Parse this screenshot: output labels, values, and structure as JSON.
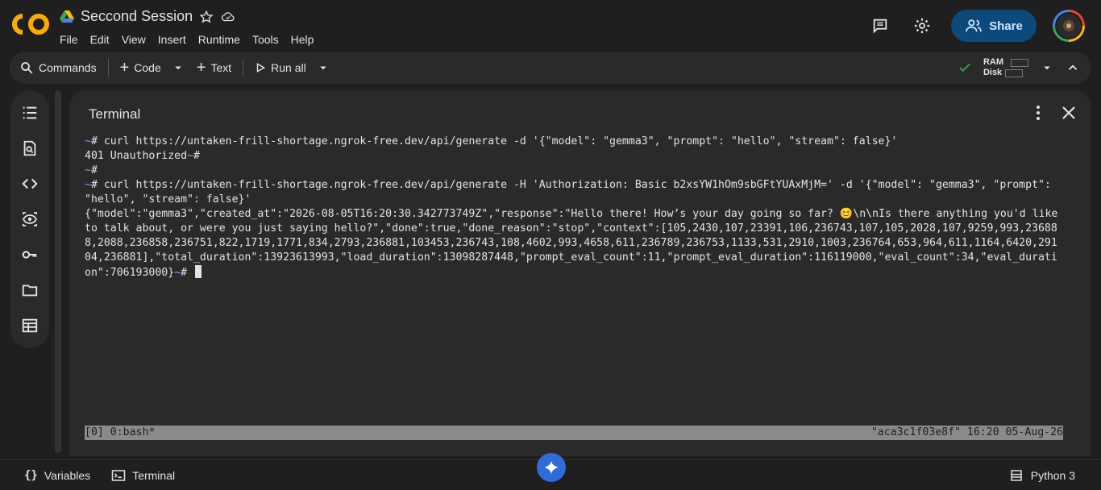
{
  "header": {
    "title": "Seccond Session",
    "menu": [
      "File",
      "Edit",
      "View",
      "Insert",
      "Runtime",
      "Tools",
      "Help"
    ],
    "share_label": "Share"
  },
  "toolbar": {
    "commands_label": "Commands",
    "code_label": "Code",
    "text_label": "Text",
    "run_all_label": "Run all",
    "ram_label": "RAM",
    "disk_label": "Disk"
  },
  "terminal": {
    "title": "Terminal",
    "cmd1": "# curl https://untaken-frill-shortage.ngrok-free.dev/api/generate -d '{\"model\": \"gemma3\", \"prompt\": \"hello\", \"stream\": false}'",
    "out1": "401 Unauthorized",
    "prompt_hash": "#",
    "cmd2": "# curl https://untaken-frill-shortage.ngrok-free.dev/api/generate -H 'Authorization: Basic b2xsYW1hOm9sbGFtYUAxMjM=' -d '{\"model\": \"gemma3\", \"prompt\": \"hello\", \"stream\": false}'",
    "out2": "{\"model\":\"gemma3\",\"created_at\":\"2026-08-05T16:20:30.342773749Z\",\"response\":\"Hello there! How’s your day going so far? 😊\\n\\nIs there anything you'd like to talk about, or were you just saying hello?\",\"done\":true,\"done_reason\":\"stop\",\"context\":[105,2430,107,23391,106,236743,107,105,2028,107,9259,993,236888,2088,236858,236751,822,1719,1771,834,2793,236881,103453,236743,108,4602,993,4658,611,236789,236753,1133,531,2910,1003,236764,653,964,611,1164,6420,29104,236881],\"total_duration\":13923613993,\"load_duration\":13098287448,\"prompt_eval_count\":11,\"prompt_eval_duration\":116119000,\"eval_count\":34,\"eval_duration\":706193000}",
    "status_left": "[0] 0:bash*",
    "status_right": "\"aca3c1f03e8f\" 16:20 05-Aug-26"
  },
  "footer": {
    "variables_label": "Variables",
    "terminal_label": "Terminal",
    "runtime_label": "Python 3"
  },
  "colors": {
    "accent": "#0b4a7a",
    "logo_orange": "#f9ab00",
    "prompt_tilde": "#6fa8ff",
    "check_green": "#34a853"
  }
}
